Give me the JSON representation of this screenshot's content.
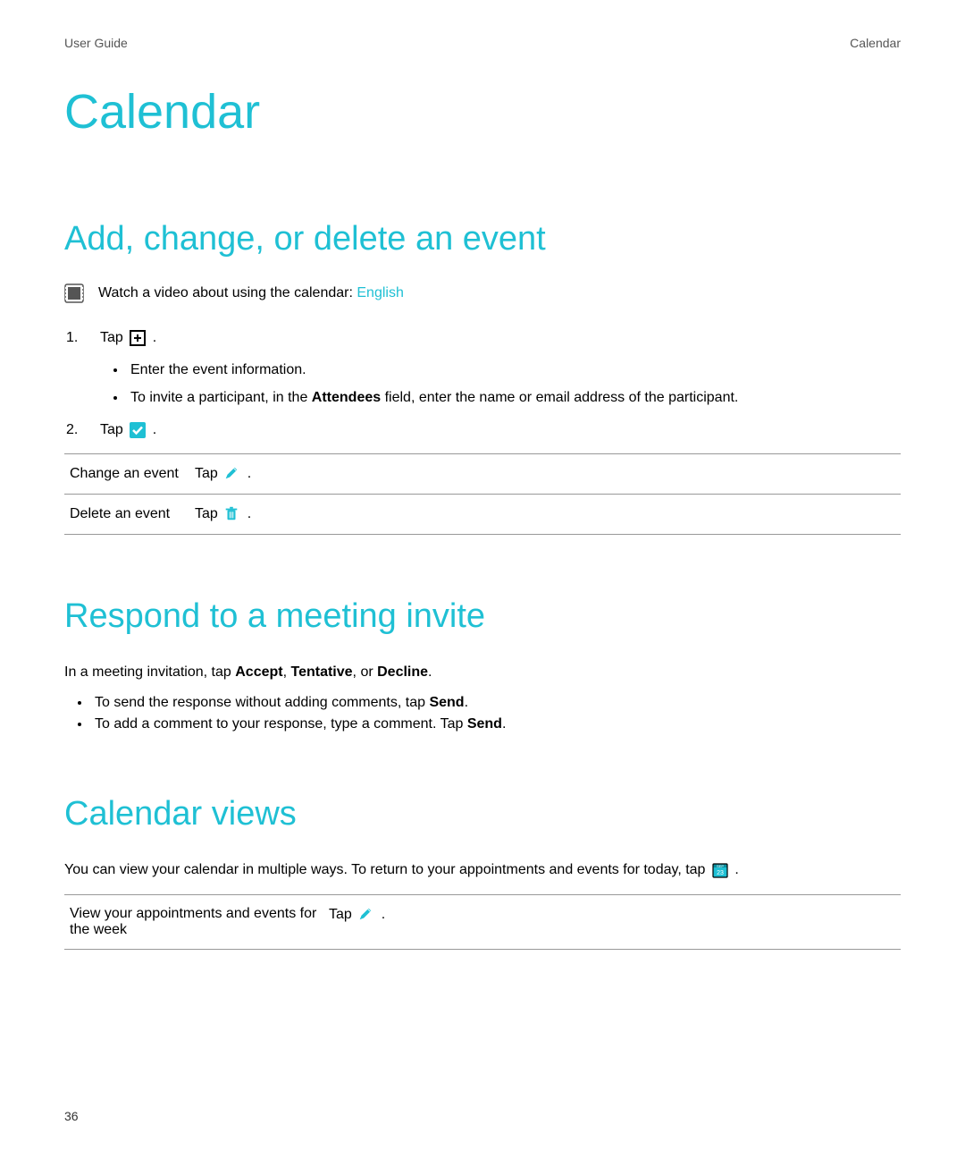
{
  "header": {
    "left": "User Guide",
    "right": "Calendar"
  },
  "title": "Calendar",
  "section1": {
    "heading": "Add, change, or delete an event",
    "video_text": "Watch a video about using the calendar: ",
    "video_link": "English",
    "tap_word": "Tap ",
    "period": " .",
    "sub_a": "Enter the event information.",
    "sub_b_pre": "To invite a participant, in the ",
    "sub_b_bold": "Attendees",
    "sub_b_post": " field, enter the name or email address of the participant.",
    "table": {
      "row1_label": "Change an event",
      "row2_label": "Delete an event"
    }
  },
  "section2": {
    "heading": "Respond to a meeting invite",
    "intro_pre": "In a meeting invitation, tap ",
    "accept": "Accept",
    "comma1": ", ",
    "tentative": "Tentative",
    "comma2": ", or ",
    "decline": "Decline",
    "intro_post": ".",
    "b1_pre": "To send the response without adding comments, tap ",
    "send": "Send",
    "b1_post": ".",
    "b2_pre": "To add a comment to your response, type a comment. Tap ",
    "b2_post": "."
  },
  "section3": {
    "heading": "Calendar views",
    "intro_pre": "You can view your calendar in multiple ways. To return to your appointments and events for today, tap ",
    "intro_post": " .",
    "table": {
      "row1_label": "View your appointments and events for the week"
    }
  },
  "page_number": "36",
  "colors": {
    "accent": "#1fc0d4"
  }
}
